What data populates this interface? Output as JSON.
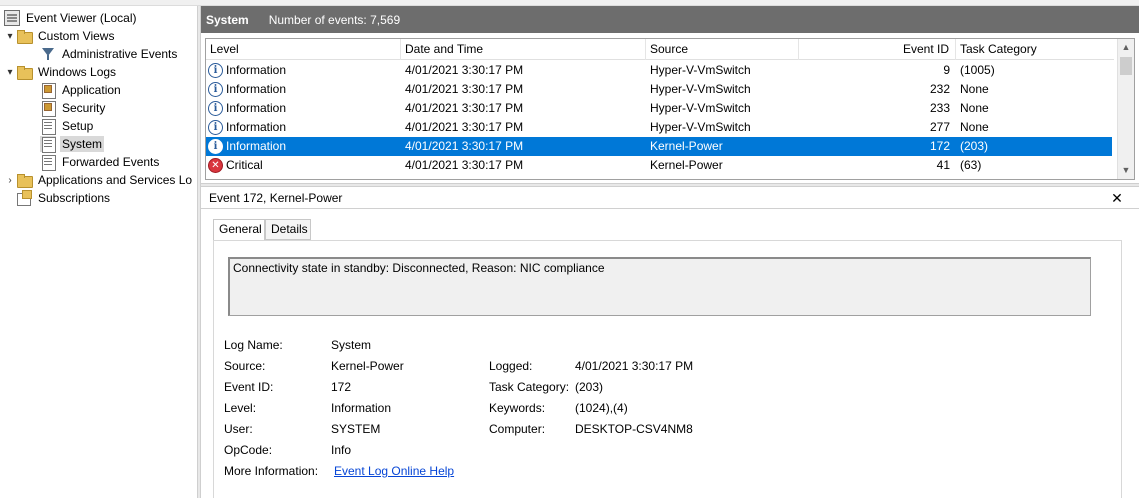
{
  "tree": {
    "items": [
      {
        "label": "Event Viewer (Local)",
        "icon": "event-viewer-icon",
        "expander": ""
      },
      {
        "label": "Custom Views",
        "icon": "folder-icon",
        "expander": "▾"
      },
      {
        "label": "Administrative Events",
        "icon": "filter-icon",
        "expander": ""
      },
      {
        "label": "Windows Logs",
        "icon": "folder-icon",
        "expander": "▾"
      },
      {
        "label": "Application",
        "icon": "log-icon",
        "expander": ""
      },
      {
        "label": "Security",
        "icon": "log-icon",
        "expander": ""
      },
      {
        "label": "Setup",
        "icon": "log-icon",
        "expander": ""
      },
      {
        "label": "System",
        "icon": "log-icon",
        "expander": ""
      },
      {
        "label": "Forwarded Events",
        "icon": "log-icon",
        "expander": ""
      },
      {
        "label": "Applications and Services Lo",
        "icon": "folder-icon",
        "expander": "›"
      },
      {
        "label": "Subscriptions",
        "icon": "subscriptions-icon",
        "expander": ""
      }
    ]
  },
  "header": {
    "title": "System",
    "count_text": "Number of events: 7,569"
  },
  "grid": {
    "columns": [
      "Level",
      "Date and Time",
      "Source",
      "Event ID",
      "Task Category"
    ],
    "rows": [
      {
        "level": "Information",
        "icon": "information-icon",
        "date": "4/01/2021 3:30:17 PM",
        "source": "Hyper-V-VmSwitch",
        "id": "9",
        "category": "(1005)"
      },
      {
        "level": "Information",
        "icon": "information-icon",
        "date": "4/01/2021 3:30:17 PM",
        "source": "Hyper-V-VmSwitch",
        "id": "232",
        "category": "None"
      },
      {
        "level": "Information",
        "icon": "information-icon",
        "date": "4/01/2021 3:30:17 PM",
        "source": "Hyper-V-VmSwitch",
        "id": "233",
        "category": "None"
      },
      {
        "level": "Information",
        "icon": "information-icon",
        "date": "4/01/2021 3:30:17 PM",
        "source": "Hyper-V-VmSwitch",
        "id": "277",
        "category": "None"
      },
      {
        "level": "Information",
        "icon": "information-icon",
        "date": "4/01/2021 3:30:17 PM",
        "source": "Kernel-Power",
        "id": "172",
        "category": "(203)"
      },
      {
        "level": "Critical",
        "icon": "critical-icon",
        "date": "4/01/2021 3:30:17 PM",
        "source": "Kernel-Power",
        "id": "41",
        "category": "(63)"
      }
    ],
    "selected_row": 4
  },
  "detail": {
    "title": "Event 172, Kernel-Power",
    "close_glyph": "✕",
    "tabs": [
      "General",
      "Details"
    ],
    "description": "Connectivity state in standby: Disconnected, Reason: NIC compliance",
    "props": {
      "log_name_label": "Log Name:",
      "log_name": "System",
      "source_label": "Source:",
      "source": "Kernel-Power",
      "logged_label": "Logged:",
      "logged": "4/01/2021 3:30:17 PM",
      "event_id_label": "Event ID:",
      "event_id": "172",
      "task_category_label": "Task Category:",
      "task_category": "(203)",
      "level_label": "Level:",
      "level": "Information",
      "keywords_label": "Keywords:",
      "keywords": "(1024),(4)",
      "user_label": "User:",
      "user": "SYSTEM",
      "computer_label": "Computer:",
      "computer": "DESKTOP-CSV4NM8",
      "opcode_label": "OpCode:",
      "opcode": "Info",
      "more_info_label": "More Information:",
      "more_info_link": "Event Log Online Help"
    }
  },
  "colors": {
    "selection": "#0078d7",
    "header_bar": "#6d6d6d",
    "link": "#0645d6"
  }
}
